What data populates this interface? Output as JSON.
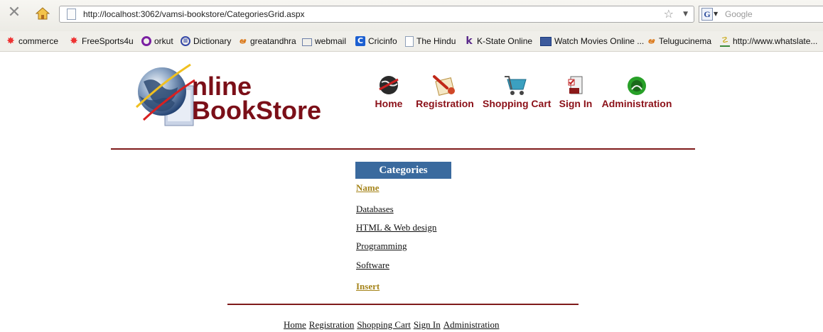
{
  "browser": {
    "url": "http://localhost:3062/vamsi-bookstore/CategoriesGrid.aspx",
    "search_placeholder": "Google",
    "search_engine_icon": "G",
    "bookmarks": [
      {
        "label": "commerce",
        "icon": "commerce-icon"
      },
      {
        "label": "FreeSports4u",
        "icon": "commerce-icon"
      },
      {
        "label": "orkut",
        "icon": "orkut-icon"
      },
      {
        "label": "Dictionary",
        "icon": "dictionary-icon"
      },
      {
        "label": "greatandhra",
        "icon": "telugu-icon"
      },
      {
        "label": "webmail",
        "icon": "mail-icon"
      },
      {
        "label": "Cricinfo",
        "icon": "cricinfo-icon"
      },
      {
        "label": "The Hindu",
        "icon": "page-icon"
      },
      {
        "label": "K-State Online",
        "icon": "kstate-icon"
      },
      {
        "label": "Watch Movies Online ...",
        "icon": "film-icon"
      },
      {
        "label": "Telugucinema",
        "icon": "telugu-icon"
      },
      {
        "label": "http://www.whatslate...",
        "icon": "link-icon"
      }
    ]
  },
  "logo": {
    "line1": "nline",
    "line2": "BookStore"
  },
  "nav": {
    "home": "Home",
    "registration": "Registration",
    "cart": "Shopping Cart",
    "signin": "Sign In",
    "admin": "Administration"
  },
  "colors": {
    "brand": "#7b0f18",
    "header_bg": "#3a6a9e",
    "link_accent": "#a5841a"
  },
  "grid": {
    "title": "Categories",
    "column_header": "Name",
    "rows": [
      "Databases",
      "HTML & Web design",
      "Programming",
      "Software"
    ],
    "insert_label": "Insert"
  },
  "footer": {
    "home": "Home",
    "registration": "Registration",
    "cart": "Shopping Cart",
    "signin": "Sign In",
    "admin": "Administration"
  }
}
